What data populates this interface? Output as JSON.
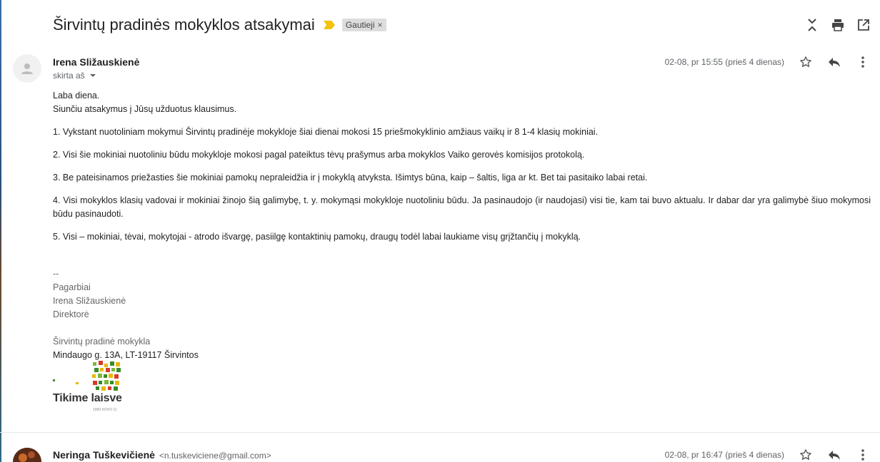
{
  "thread": {
    "subject": "Širvintų pradinės mokyklos atsakymai",
    "label": "Gautieji",
    "label_close": "×",
    "importance_color": "#f4c20d"
  },
  "top_actions": [
    "collapse-all-icon",
    "print-icon",
    "open-in-new-window-icon"
  ],
  "messages": [
    {
      "sender_name": "Irena Sližauskienė",
      "recipient_text": "skirta aš",
      "date": "02-08, pr 15:55 (prieš 4 dienas)",
      "body": {
        "greeting": "Laba diena.",
        "intro": "Siunčiu atsakymus į Jūsų užduotus klausimus.",
        "items": [
          "1. Vykstant nuotoliniam mokymui Širvintų pradinėje mokykloje šiai dienai mokosi 15 priešmokyklinio amžiaus vaikų ir 8 1-4 klasių mokiniai.",
          "2. Visi šie mokiniai nuotoliniu būdu mokykloje mokosi pagal pateiktus tėvų prašymus arba mokyklos Vaiko gerovės komisijos protokolą.",
          "3. Be pateisinamos priežasties šie mokiniai pamokų nepraleidžia ir į mokyklą atvyksta. Išimtys būna, kaip – šaltis, liga ar kt. Bet tai pasitaiko labai retai.",
          "4.  Visi mokyklos klasių vadovai ir mokiniai žinojo šią galimybę, t. y. mokymąsi mokykloje nuotoliniu būdu. Ja pasinaudojo (ir naudojasi) visi tie, kam tai buvo aktualu. Ir dabar dar yra galimybė šiuo mokymosi būdu pasinaudoti.",
          "5. Visi – mokiniai, tėvai, mokytojai - atrodo išvargę, pasiilgę kontaktinių pamokų, draugų todėl labai laukiame visų grįžtančių į mokyklą."
        ]
      },
      "signature": {
        "separator": "--",
        "regards": "Pagarbiai",
        "name": "Irena Sližauskienė",
        "position": "Direktorė",
        "school": "Širvintų pradinė mokykla",
        "address": "Mindaugo g. 13A, LT-19117 Širvintos"
      },
      "logo": {
        "text": "Tikime laisve",
        "subtext": "1990 KOVO 11",
        "colors": [
          "#e8b800",
          "#3a8a2a",
          "#d83a2a",
          "#7ab83a"
        ]
      }
    },
    {
      "sender_name": "Neringa Tuškevičienė",
      "sender_email": "<n.tuskeviciene@gmail.com>",
      "date": "02-08, pr 16:47 (prieš 4 dienas)"
    }
  ]
}
